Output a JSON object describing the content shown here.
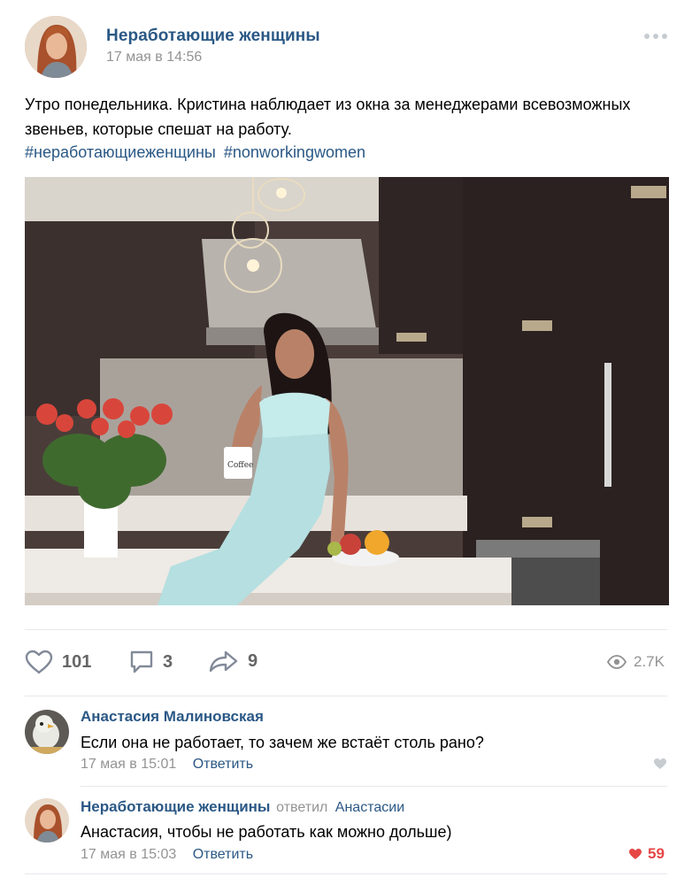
{
  "post": {
    "group_name": "Неработающие женщины",
    "date": "17 мая в 14:56",
    "text": "Утро понедельника. Кристина наблюдает из окна за менеджерами всевозможных звеньев, которые спешат на работу.",
    "hashtags": [
      "#неработающиеженщины",
      "#nonworkingwomen"
    ],
    "photo_mug_text": "Coffee"
  },
  "actions": {
    "likes": "101",
    "comments": "3",
    "shares": "9",
    "views": "2.7K",
    "icons": [
      "heart-outline-icon",
      "comment-icon",
      "share-arrow-icon",
      "eye-icon"
    ]
  },
  "comments": [
    {
      "author": "Анастасия Малиновская",
      "text": "Если она не работает, то зачем же встаёт столь рано?",
      "date": "17 мая в 15:01",
      "reply_label": "Ответить",
      "likes": ""
    },
    {
      "author": "Неработающие женщины",
      "replied_label": "ответил",
      "replied_to": "Анастасии",
      "text": "Анастасия, чтобы не работать как можно дольше)",
      "date": "17 мая в 15:03",
      "reply_label": "Ответить",
      "likes": "59"
    }
  ],
  "colors": {
    "link": "#2a5885",
    "muted": "#939393",
    "like_active": "#e64646",
    "icon": "#828a99"
  }
}
